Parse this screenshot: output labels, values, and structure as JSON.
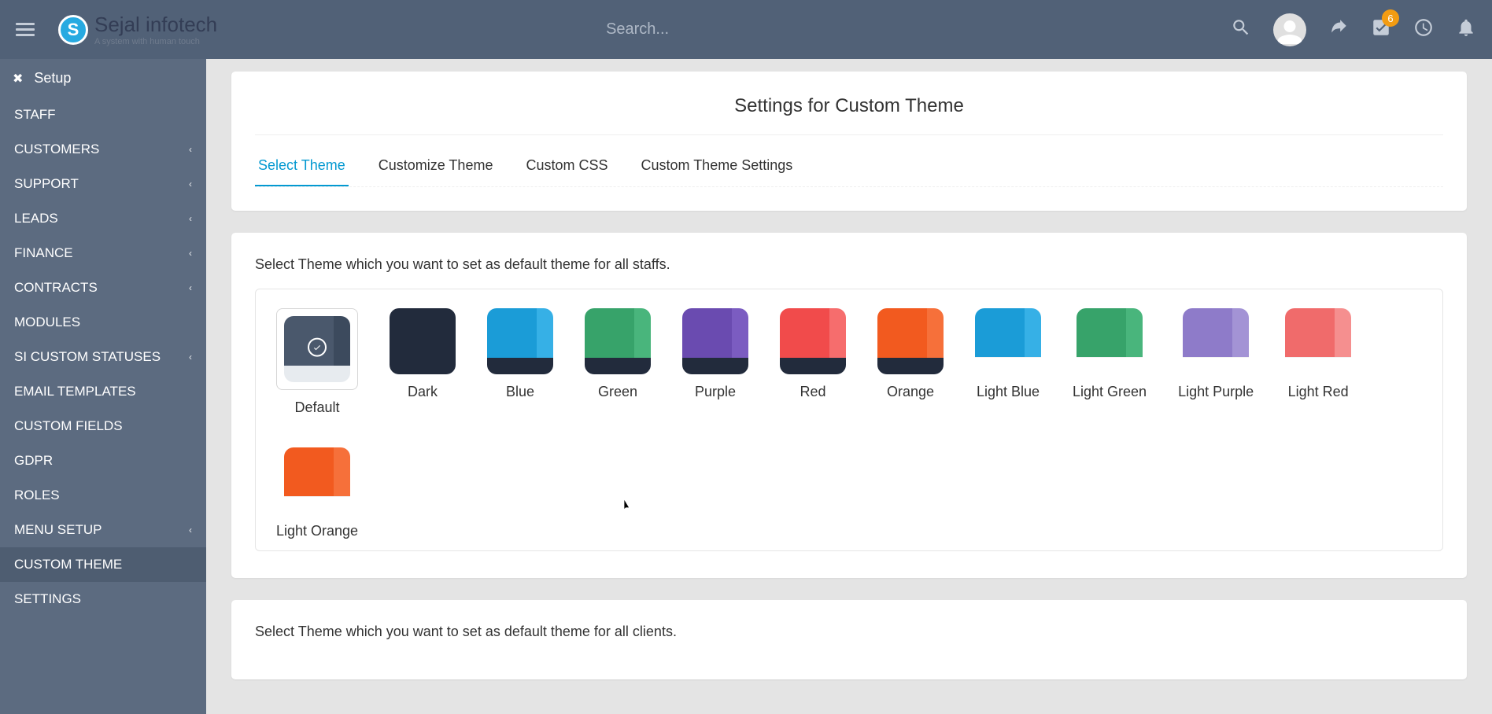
{
  "header": {
    "brand_icon_letter": "S",
    "brand_name_1": "Sejal",
    "brand_name_2": " infotech",
    "brand_tagline": "A system with human touch",
    "search_placeholder": "Search...",
    "badge_count": "6"
  },
  "sidebar": {
    "close_label": "✖",
    "title": "Setup",
    "items": [
      {
        "label": "STAFF",
        "has_children": false,
        "active": false
      },
      {
        "label": "CUSTOMERS",
        "has_children": true,
        "active": false
      },
      {
        "label": "SUPPORT",
        "has_children": true,
        "active": false
      },
      {
        "label": "LEADS",
        "has_children": true,
        "active": false
      },
      {
        "label": "FINANCE",
        "has_children": true,
        "active": false
      },
      {
        "label": "CONTRACTS",
        "has_children": true,
        "active": false
      },
      {
        "label": "MODULES",
        "has_children": false,
        "active": false
      },
      {
        "label": "SI CUSTOM STATUSES",
        "has_children": true,
        "active": false
      },
      {
        "label": "EMAIL TEMPLATES",
        "has_children": false,
        "active": false
      },
      {
        "label": "CUSTOM FIELDS",
        "has_children": false,
        "active": false
      },
      {
        "label": "GDPR",
        "has_children": false,
        "active": false
      },
      {
        "label": "ROLES",
        "has_children": false,
        "active": false
      },
      {
        "label": "MENU SETUP",
        "has_children": true,
        "active": false
      },
      {
        "label": "CUSTOM THEME",
        "has_children": false,
        "active": true
      },
      {
        "label": "SETTINGS",
        "has_children": false,
        "active": false
      }
    ]
  },
  "page": {
    "title": "Settings for Custom Theme",
    "tabs": [
      {
        "label": "Select Theme",
        "active": true
      },
      {
        "label": "Customize Theme",
        "active": false
      },
      {
        "label": "Custom CSS",
        "active": false
      },
      {
        "label": "Custom Theme Settings",
        "active": false
      }
    ],
    "staff_desc": "Select Theme which you want to set as default theme for all staffs.",
    "client_desc": "Select Theme which you want to set as default theme for all clients."
  },
  "themes": [
    {
      "label": "Default",
      "main": "#4a586c",
      "accent": "#3c4a5d",
      "bottom": "#e7ebef",
      "selected": true,
      "light_bottom": false
    },
    {
      "label": "Dark",
      "main": "#222b3c",
      "accent": "#222b3c",
      "bottom": "#222b3c",
      "selected": false,
      "light_bottom": false
    },
    {
      "label": "Blue",
      "main": "#1b9cd7",
      "accent": "#36b0e6",
      "bottom": "#222b3c",
      "selected": false,
      "light_bottom": false
    },
    {
      "label": "Green",
      "main": "#37a36a",
      "accent": "#49b57c",
      "bottom": "#222b3c",
      "selected": false,
      "light_bottom": false
    },
    {
      "label": "Purple",
      "main": "#6a4bb0",
      "accent": "#7b5cc1",
      "bottom": "#222b3c",
      "selected": false,
      "light_bottom": false
    },
    {
      "label": "Red",
      "main": "#f14b4b",
      "accent": "#f66d6d",
      "bottom": "#222b3c",
      "selected": false,
      "light_bottom": false
    },
    {
      "label": "Orange",
      "main": "#f25a1f",
      "accent": "#f6703a",
      "bottom": "#222b3c",
      "selected": false,
      "light_bottom": false
    },
    {
      "label": "Light Blue",
      "main": "#1b9cd7",
      "accent": "#36b0e6",
      "bottom": "#ffffff",
      "selected": false,
      "light_bottom": true
    },
    {
      "label": "Light Green",
      "main": "#37a36a",
      "accent": "#49b57c",
      "bottom": "#ffffff",
      "selected": false,
      "light_bottom": true
    },
    {
      "label": "Light Purple",
      "main": "#8e7bc9",
      "accent": "#a393d5",
      "bottom": "#ffffff",
      "selected": false,
      "light_bottom": true
    },
    {
      "label": "Light Red",
      "main": "#f06b6b",
      "accent": "#f58f8f",
      "bottom": "#ffffff",
      "selected": false,
      "light_bottom": true
    },
    {
      "label": "Light Orange",
      "main": "#f25a1f",
      "accent": "#f6703a",
      "bottom": "#ffffff",
      "selected": false,
      "light_bottom": true
    }
  ]
}
